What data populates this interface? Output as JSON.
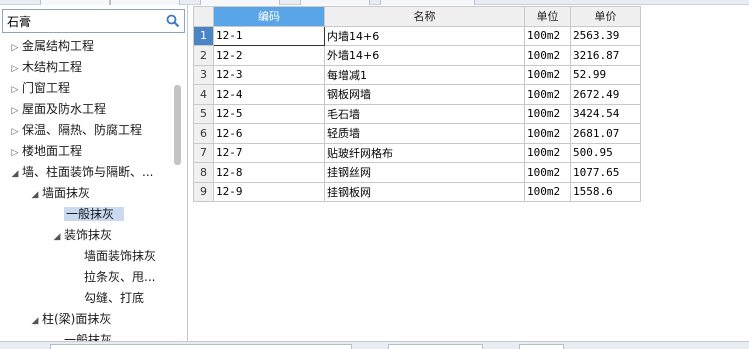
{
  "search": {
    "value": "石膏",
    "icon": "search-icon"
  },
  "tree": [
    {
      "label": "金属结构工程",
      "level": 0,
      "expanded": false
    },
    {
      "label": "木结构工程",
      "level": 0,
      "expanded": false
    },
    {
      "label": "门窗工程",
      "level": 0,
      "expanded": false
    },
    {
      "label": "屋面及防水工程",
      "level": 0,
      "expanded": false
    },
    {
      "label": "保温、隔热、防腐工程",
      "level": 0,
      "expanded": false
    },
    {
      "label": "楼地面工程",
      "level": 0,
      "expanded": false
    },
    {
      "label": "墙、柱面装饰与隔断、...",
      "level": 0,
      "expanded": true
    },
    {
      "label": "墙面抹灰",
      "level": 1,
      "expanded": true
    },
    {
      "label": "一般抹灰",
      "level": 2,
      "leaf": true,
      "selected": true
    },
    {
      "label": "装饰抹灰",
      "level": 2,
      "expanded": true
    },
    {
      "label": "墙面装饰抹灰",
      "level": 3,
      "leaf": true
    },
    {
      "label": "拉条灰、甩...",
      "level": 3,
      "leaf": true
    },
    {
      "label": "勾缝、打底",
      "level": 3,
      "leaf": true
    },
    {
      "label": "柱(梁)面抹灰",
      "level": 1,
      "expanded": true
    },
    {
      "label": "一般抹灰",
      "level": 2,
      "leaf": true
    }
  ],
  "grid": {
    "columns": [
      "编码",
      "名称",
      "单位",
      "单价"
    ],
    "active_column": 0,
    "rows": [
      {
        "num": "1",
        "code": "12-1",
        "name": "内墙14+6",
        "unit": "100m2",
        "price": "2563.39"
      },
      {
        "num": "2",
        "code": "12-2",
        "name": "外墙14+6",
        "unit": "100m2",
        "price": "3216.87"
      },
      {
        "num": "3",
        "code": "12-3",
        "name": "每增减1",
        "unit": "100m2",
        "price": "52.99"
      },
      {
        "num": "4",
        "code": "12-4",
        "name": "钢板网墙",
        "unit": "100m2",
        "price": "2672.49"
      },
      {
        "num": "5",
        "code": "12-5",
        "name": "毛石墙",
        "unit": "100m2",
        "price": "3424.54"
      },
      {
        "num": "6",
        "code": "12-6",
        "name": "轻质墙",
        "unit": "100m2",
        "price": "2681.07"
      },
      {
        "num": "7",
        "code": "12-7",
        "name": "贴玻纤网格布",
        "unit": "100m2",
        "price": "500.95"
      },
      {
        "num": "8",
        "code": "12-8",
        "name": "挂钢丝网",
        "unit": "100m2",
        "price": "1077.65"
      },
      {
        "num": "9",
        "code": "12-9",
        "name": "挂钢板网",
        "unit": "100m2",
        "price": "1558.6"
      }
    ]
  },
  "colors": {
    "header_active": "#5aa5e8",
    "row_active": "#4a86c5",
    "selected_tree_item": "#c8d9f0"
  }
}
